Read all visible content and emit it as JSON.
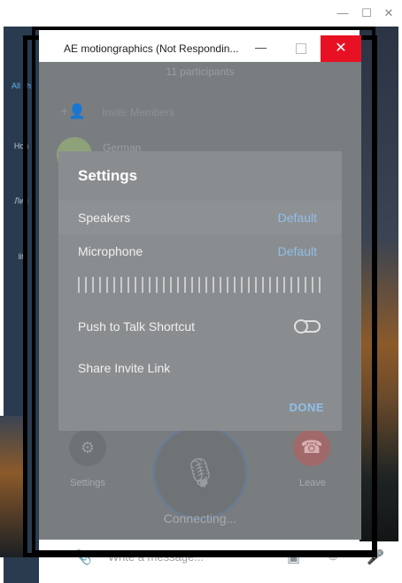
{
  "outer_window": {
    "minimize_glyph": "—",
    "maximize_glyph": "☐",
    "close_glyph": "✕"
  },
  "sidebar": {
    "items": [
      {
        "label": "All ch",
        "icon": "chat-bubble-icon"
      },
      {
        "label": "Нов",
        "icon": "chat-bubbles-icon"
      },
      {
        "label": "Лич",
        "icon": "person-icon"
      },
      {
        "label": "lit",
        "icon": "folder-icon"
      }
    ]
  },
  "call_window": {
    "title": "AE motiongraphics (Not Respondin...",
    "minimize_glyph": "—",
    "close_glyph": "✕",
    "participants": "11 participants",
    "invite_label": "Invite Members",
    "member_name": "German",
    "settings_label": "Settings",
    "leave_label": "Leave",
    "connecting": "Connecting...",
    "settings_glyph": "⚙",
    "mute_glyph": "🎙",
    "leave_glyph": "☎",
    "invite_glyph": "+👤"
  },
  "settings_panel": {
    "title": "Settings",
    "speakers_label": "Speakers",
    "speakers_value": "Default",
    "microphone_label": "Microphone",
    "microphone_value": "Default",
    "push_to_talk_label": "Push to Talk Shortcut",
    "push_to_talk_enabled": false,
    "share_link_label": "Share Invite Link",
    "done_label": "DONE"
  },
  "message_bar": {
    "placeholder": "Write a message..."
  },
  "colors": {
    "close_red": "#e81123",
    "accent_blue": "#8fbfe8",
    "panel_gray": "#8a8d90"
  }
}
